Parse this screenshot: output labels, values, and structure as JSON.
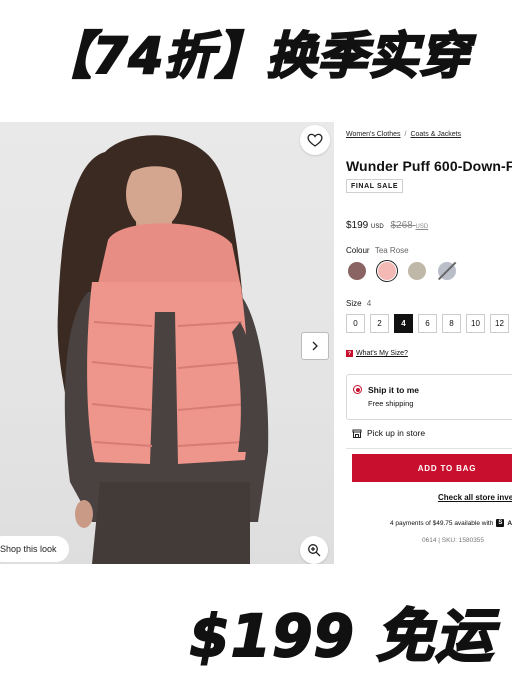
{
  "banner_top": "【74折】换季实穿",
  "banner_bottom": "$199 免运",
  "image": {
    "shop_look": "Shop this look"
  },
  "breadcrumb": [
    "Women's Clothes",
    "Coats & Jackets"
  ],
  "breadcrumb_sep": "/",
  "product": {
    "title": "Wunder Puff 600-Down-F",
    "badge": "FINAL SALE",
    "price": "$199",
    "price_currency": "USD",
    "old_price": "$268",
    "old_currency": "USD"
  },
  "colour": {
    "label": "Colour",
    "value": "Tea Rose",
    "swatches": [
      "#8a6462",
      "#f4b9b4",
      "#bfb7a8",
      "#b9bec9"
    ]
  },
  "size": {
    "label": "Size",
    "value": "4",
    "options": [
      "0",
      "2",
      "4",
      "6",
      "8",
      "10",
      "12"
    ],
    "selected": "4",
    "whats_my_size": "What's My Size?"
  },
  "shipping": {
    "ship_title": "Ship it to me",
    "ship_sub": "Free shipping",
    "pickup": "Pick up in store"
  },
  "actions": {
    "add_to_bag": "ADD TO BAG",
    "check_store": "Check all store inve"
  },
  "payments": "4 payments of $49.75 available with",
  "sku": "0614 | SKU: 1580355",
  "colors": {
    "accent": "#c8102e",
    "jacket": "#ee958c"
  }
}
